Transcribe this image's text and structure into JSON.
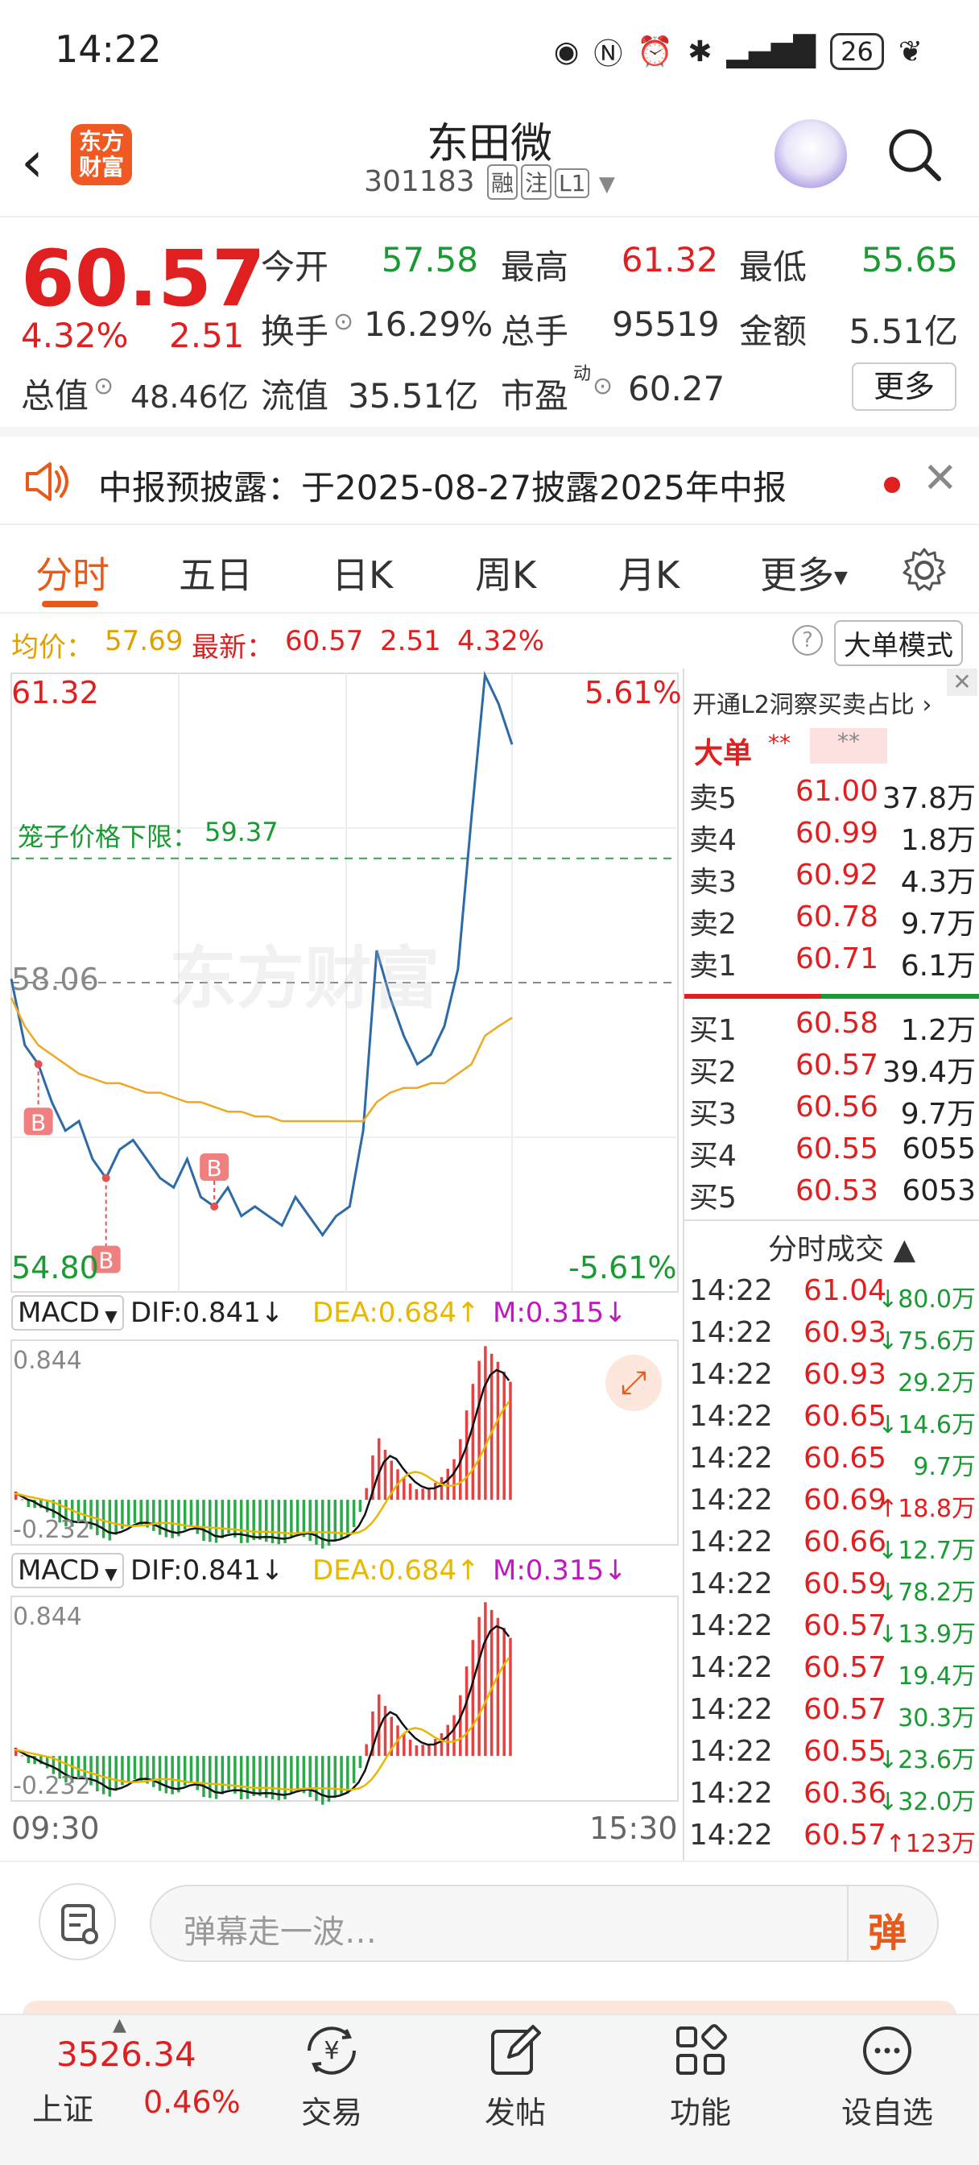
{
  "status": {
    "time": "14:22",
    "battery": "26"
  },
  "header": {
    "logo_line1": "东方",
    "logo_line2": "财富",
    "name": "东田微",
    "code": "301183",
    "tags": [
      "融",
      "注",
      "L1"
    ]
  },
  "quote": {
    "price": "60.57",
    "pct": "4.32%",
    "change": "2.51",
    "open_label": "今开",
    "open": "57.58",
    "high_label": "最高",
    "high": "61.32",
    "low_label": "最低",
    "low": "55.65",
    "turnover_label": "换手",
    "turnover": "16.29%",
    "volume_label": "总手",
    "volume": "95519",
    "amount_label": "金额",
    "amount": "5.51亿",
    "mktcap_label": "总值",
    "mktcap": "48.46亿",
    "float_label": "流值",
    "float": "35.51亿",
    "pe_label": "市盈",
    "pe_sup": "动",
    "pe": "60.27",
    "more": "更多"
  },
  "notice": {
    "text": "中报预披露：于2025-08-27披露2025年中报"
  },
  "tabs": [
    "分时",
    "五日",
    "日K",
    "周K",
    "月K",
    "更多"
  ],
  "info": {
    "avg_label": "均价：",
    "avg": "57.69",
    "latest_label": "最新：",
    "latest": "60.57",
    "chg": "2.51",
    "pct": "4.32%",
    "mode": "大单模式"
  },
  "chart": {
    "y_high": "61.32",
    "y_low": "54.80",
    "pct_high": "5.61%",
    "pct_low": "-5.61%",
    "prev_close": "58.06",
    "limit_label": "笼子价格下限：",
    "limit": "59.37",
    "watermark": "东方财富",
    "t_start": "09:30",
    "t_end": "15:30",
    "macd": {
      "name": "MACD",
      "dif": "DIF:0.841",
      "dea": "DEA:0.684",
      "m": "M:0.315",
      "top": "0.844",
      "bottom": "-0.232"
    }
  },
  "chart_data": {
    "type": "line",
    "title": "",
    "series": [
      {
        "name": "",
        "values": [
          58.1,
          57.4,
          57.2,
          56.8,
          56.5,
          56.6,
          56.2,
          56.0,
          56.3,
          56.4,
          56.2,
          56.0,
          55.9,
          56.2,
          55.8,
          55.7,
          55.9,
          55.6,
          55.7,
          55.6,
          55.5,
          55.8,
          55.6,
          55.4,
          55.6,
          55.7,
          56.5,
          58.4,
          57.9,
          57.5,
          57.2,
          57.3,
          57.6,
          58.2,
          59.8,
          61.3,
          61.0,
          60.57
        ]
      },
      {
        "name": "均价",
        "values": [
          57.9,
          57.6,
          57.4,
          57.3,
          57.2,
          57.1,
          57.05,
          57.0,
          57.0,
          56.95,
          56.9,
          56.9,
          56.85,
          56.8,
          56.8,
          56.75,
          56.7,
          56.7,
          56.65,
          56.65,
          56.6,
          56.6,
          56.6,
          56.6,
          56.6,
          56.6,
          56.6,
          56.8,
          56.9,
          56.95,
          56.95,
          57.0,
          57.0,
          57.1,
          57.2,
          57.5,
          57.6,
          57.69
        ]
      }
    ],
    "ylim": [
      54.8,
      61.32
    ]
  },
  "book": {
    "l2": "开通L2洞察买卖占比",
    "big": "大单",
    "stars": "**",
    "asks": [
      {
        "l": "卖5",
        "p": "61.00",
        "v": "37.8万"
      },
      {
        "l": "卖4",
        "p": "60.99",
        "v": "1.8万"
      },
      {
        "l": "卖3",
        "p": "60.92",
        "v": "4.3万"
      },
      {
        "l": "卖2",
        "p": "60.78",
        "v": "9.7万"
      },
      {
        "l": "卖1",
        "p": "60.71",
        "v": "6.1万"
      }
    ],
    "bids": [
      {
        "l": "买1",
        "p": "60.58",
        "v": "1.2万"
      },
      {
        "l": "买2",
        "p": "60.57",
        "v": "39.4万"
      },
      {
        "l": "买3",
        "p": "60.56",
        "v": "9.7万"
      },
      {
        "l": "买4",
        "p": "60.55",
        "v": "6055"
      },
      {
        "l": "买5",
        "p": "60.53",
        "v": "6053"
      }
    ],
    "trades_title": "分时成交",
    "trades": [
      {
        "t": "14:22",
        "p": "61.04",
        "v": "↓80.0万"
      },
      {
        "t": "14:22",
        "p": "60.93",
        "v": "↓75.6万"
      },
      {
        "t": "14:22",
        "p": "60.93",
        "v": "29.2万"
      },
      {
        "t": "14:22",
        "p": "60.65",
        "v": "↓14.6万"
      },
      {
        "t": "14:22",
        "p": "60.65",
        "v": "9.7万"
      },
      {
        "t": "14:22",
        "p": "60.69",
        "v": "↑18.8万"
      },
      {
        "t": "14:22",
        "p": "60.66",
        "v": "↓12.7万"
      },
      {
        "t": "14:22",
        "p": "60.59",
        "v": "↓78.2万"
      },
      {
        "t": "14:22",
        "p": "60.57",
        "v": "↓13.9万"
      },
      {
        "t": "14:22",
        "p": "60.57",
        "v": "19.4万"
      },
      {
        "t": "14:22",
        "p": "60.57",
        "v": "30.3万"
      },
      {
        "t": "14:22",
        "p": "60.55",
        "v": "↓23.6万"
      },
      {
        "t": "14:22",
        "p": "60.36",
        "v": "↓32.0万"
      },
      {
        "t": "14:22",
        "p": "60.57",
        "v": "↑123万"
      }
    ]
  },
  "comment": {
    "placeholder": "弹幕走一波…",
    "btn": "弹"
  },
  "nav": {
    "index_value": "3526.34",
    "index_name": "上证",
    "index_pct": "0.46%",
    "items": [
      "交易",
      "发帖",
      "功能",
      "设自选"
    ]
  }
}
